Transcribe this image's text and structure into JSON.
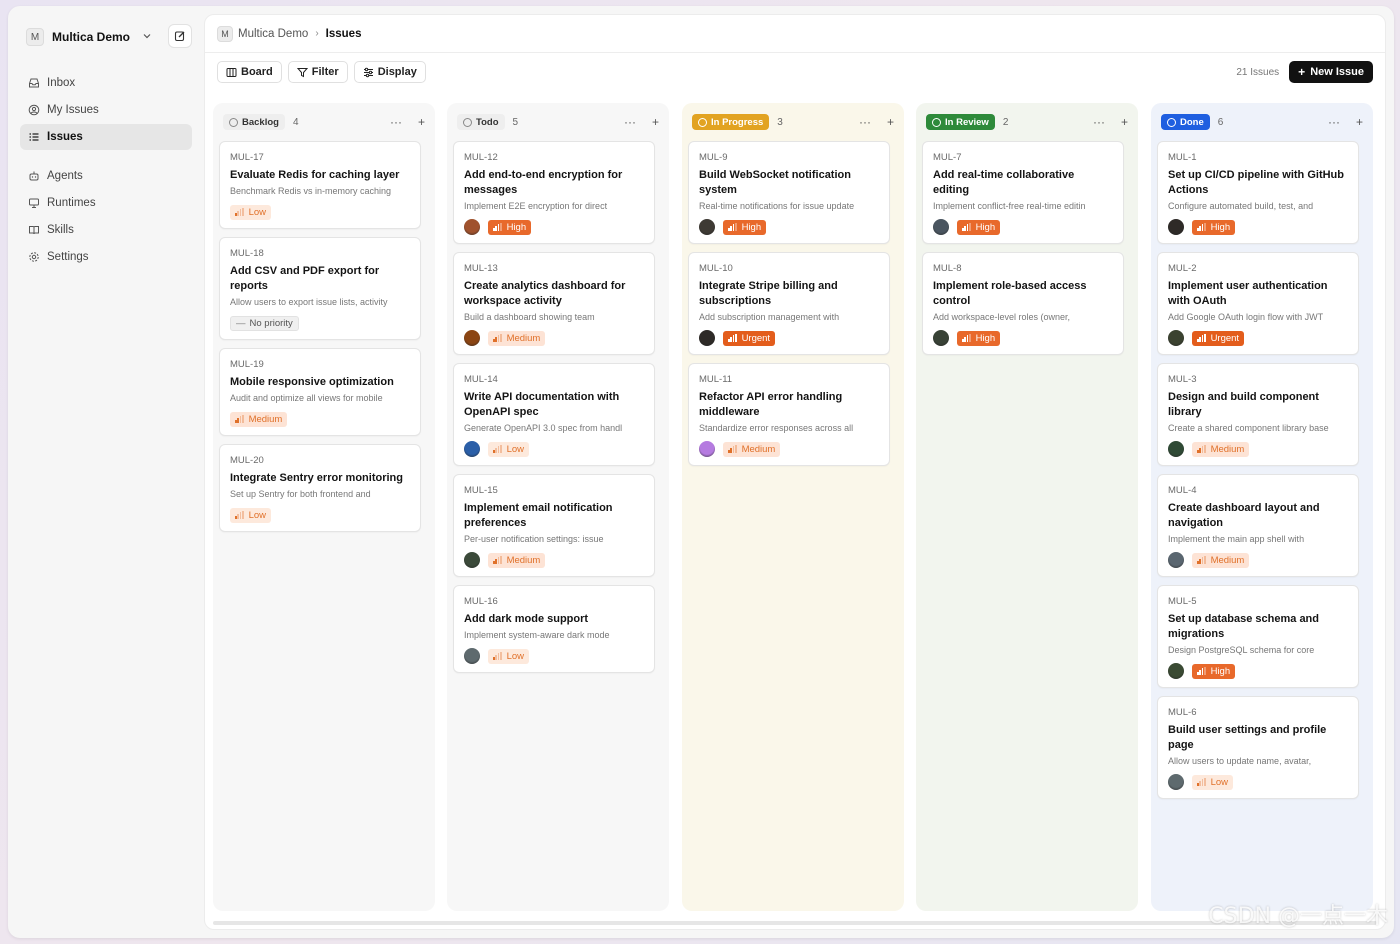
{
  "sidebar": {
    "workspace_initial": "M",
    "workspace_name": "Multica Demo",
    "items": [
      {
        "label": "Inbox",
        "icon": "inbox-icon"
      },
      {
        "label": "My Issues",
        "icon": "user-circle-icon"
      },
      {
        "label": "Issues",
        "icon": "list-icon",
        "active": true
      },
      {
        "label": "Agents",
        "icon": "bot-icon"
      },
      {
        "label": "Runtimes",
        "icon": "monitor-icon"
      },
      {
        "label": "Skills",
        "icon": "book-icon"
      },
      {
        "label": "Settings",
        "icon": "gear-icon"
      }
    ]
  },
  "header": {
    "workspace_initial": "M",
    "breadcrumb_parent": "Multica Demo",
    "breadcrumb_current": "Issues"
  },
  "toolbar": {
    "board_label": "Board",
    "filter_label": "Filter",
    "display_label": "Display",
    "issue_count": "21 Issues",
    "new_issue_label": "New Issue"
  },
  "columns": [
    {
      "name": "Backlog",
      "count": "4",
      "accent": "#f7f7f7",
      "pill_bg": "#eeeeee",
      "pill_fg": "#333333",
      "cards": [
        {
          "id": "MUL-17",
          "title": "Evaluate Redis for caching layer",
          "desc": "Benchmark Redis vs in-memory caching",
          "priority": "Low"
        },
        {
          "id": "MUL-18",
          "title": "Add CSV and PDF export for reports",
          "desc": "Allow users to export issue lists, activity",
          "priority": "No priority"
        },
        {
          "id": "MUL-19",
          "title": "Mobile responsive optimization",
          "desc": "Audit and optimize all views for mobile",
          "priority": "Medium"
        },
        {
          "id": "MUL-20",
          "title": "Integrate Sentry error monitoring",
          "desc": "Set up Sentry for both frontend and",
          "priority": "Low"
        }
      ]
    },
    {
      "name": "Todo",
      "count": "5",
      "accent": "#f7f7f7",
      "pill_bg": "#eeeeee",
      "pill_fg": "#333333",
      "cards": [
        {
          "id": "MUL-12",
          "title": "Add end-to-end encryption for messages",
          "desc": "Implement E2E encryption for direct",
          "priority": "High",
          "avatar": "#a0522d"
        },
        {
          "id": "MUL-13",
          "title": "Create analytics dashboard for workspace activity",
          "desc": "Build a dashboard showing team",
          "priority": "Medium",
          "avatar": "#8b4513"
        },
        {
          "id": "MUL-14",
          "title": "Write API documentation with OpenAPI spec",
          "desc": "Generate OpenAPI 3.0 spec from handl",
          "priority": "Low",
          "avatar": "#2b5fa8"
        },
        {
          "id": "MUL-15",
          "title": "Implement email notification preferences",
          "desc": "Per-user notification settings: issue",
          "priority": "Medium",
          "avatar": "#3b4a3a"
        },
        {
          "id": "MUL-16",
          "title": "Add dark mode support",
          "desc": "Implement system-aware dark mode",
          "priority": "Low",
          "avatar": "#5e6a6e"
        }
      ]
    },
    {
      "name": "In Progress",
      "count": "3",
      "accent": "#faf7ea",
      "pill_bg": "#e2a321",
      "pill_fg": "#ffffff",
      "cards": [
        {
          "id": "MUL-9",
          "title": "Build WebSocket notification system",
          "desc": "Real-time notifications for issue update",
          "priority": "High",
          "avatar": "#3e3a34"
        },
        {
          "id": "MUL-10",
          "title": "Integrate Stripe billing and subscriptions",
          "desc": "Add subscription management with",
          "priority": "Urgent",
          "avatar": "#2e2a27"
        },
        {
          "id": "MUL-11",
          "title": "Refactor API error handling middleware",
          "desc": "Standardize error responses across all",
          "priority": "Medium",
          "avatar": "#b57be0"
        }
      ]
    },
    {
      "name": "In Review",
      "count": "2",
      "accent": "#f2f5ee",
      "pill_bg": "#2e8a3a",
      "pill_fg": "#ffffff",
      "cards": [
        {
          "id": "MUL-7",
          "title": "Add real-time collaborative editing",
          "desc": "Implement conflict-free real-time editin",
          "priority": "High",
          "avatar": "#4a5560"
        },
        {
          "id": "MUL-8",
          "title": "Implement role-based access control",
          "desc": "Add workspace-level roles (owner,",
          "priority": "High",
          "avatar": "#384236"
        }
      ]
    },
    {
      "name": "Done",
      "count": "6",
      "accent": "#eef2fa",
      "pill_bg": "#1f5fe0",
      "pill_fg": "#ffffff",
      "cards": [
        {
          "id": "MUL-1",
          "title": "Set up CI/CD pipeline with GitHub Actions",
          "desc": "Configure automated build, test, and",
          "priority": "High",
          "avatar": "#2e2a27"
        },
        {
          "id": "MUL-2",
          "title": "Implement user authentication with OAuth",
          "desc": "Add Google OAuth login flow with JWT",
          "priority": "Urgent",
          "avatar": "#3b4230"
        },
        {
          "id": "MUL-3",
          "title": "Design and build component library",
          "desc": "Create a shared component library base",
          "priority": "Medium",
          "avatar": "#2f4a35"
        },
        {
          "id": "MUL-4",
          "title": "Create dashboard layout and navigation",
          "desc": "Implement the main app shell with",
          "priority": "Medium",
          "avatar": "#5a6670"
        },
        {
          "id": "MUL-5",
          "title": "Set up database schema and migrations",
          "desc": "Design PostgreSQL schema for core",
          "priority": "High",
          "avatar": "#3a4a33"
        },
        {
          "id": "MUL-6",
          "title": "Build user settings and profile page",
          "desc": "Allow users to update name, avatar,",
          "priority": "Low",
          "avatar": "#5e6a6e"
        }
      ]
    }
  ],
  "watermark": "CSDN @一点一木"
}
